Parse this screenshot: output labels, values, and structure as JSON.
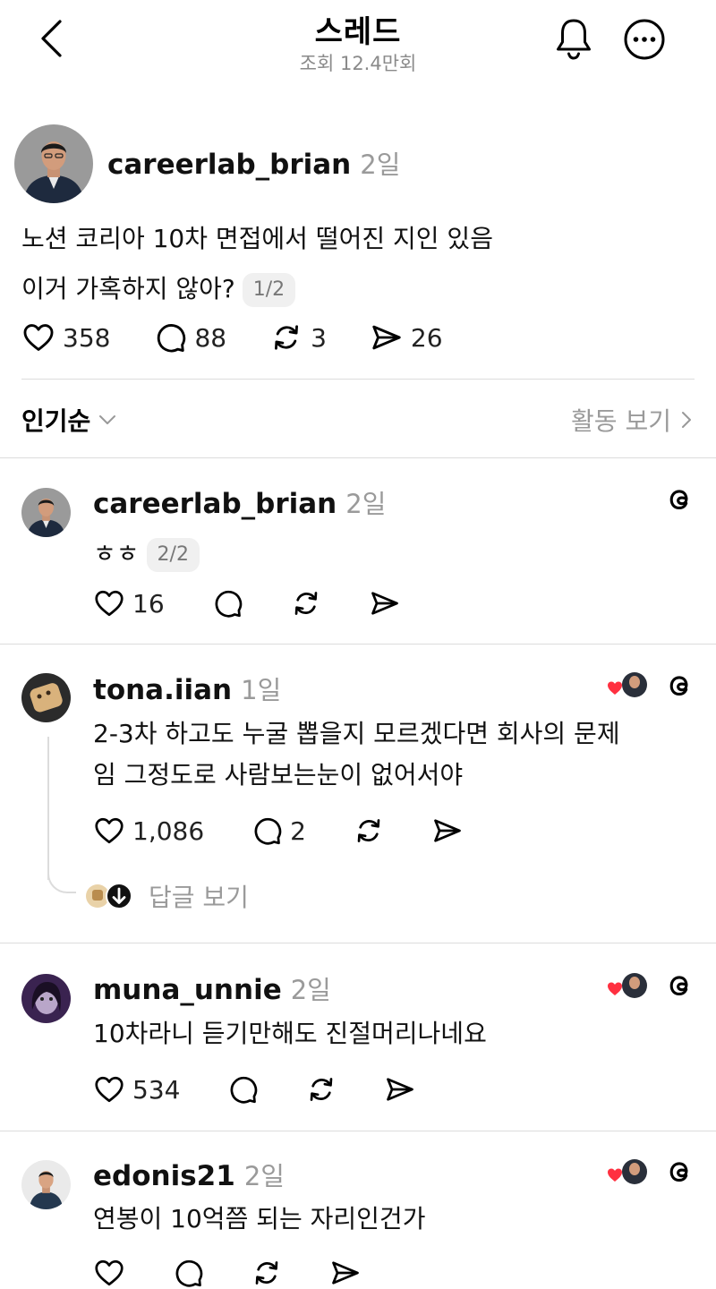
{
  "header": {
    "title": "스레드",
    "views": "조회 12.4만회"
  },
  "post": {
    "username": "careerlab_brian",
    "time": "2일",
    "line1": "노션 코리아 10차 면접에서 떨어진 지인 있음",
    "line2": "이거 가혹하지 않아?",
    "pager": "1/2",
    "likes": "358",
    "comments": "88",
    "reposts": "3",
    "shares": "26"
  },
  "sort": {
    "label": "인기순",
    "activity": "활동 보기"
  },
  "replies": [
    {
      "username": "careerlab_brian",
      "time": "2일",
      "text": "ㅎㅎ",
      "pager": "2/2",
      "likes": "16"
    },
    {
      "username": "tona.iian",
      "time": "1일",
      "line1": "2-3차 하고도 누굴 뽑을지 모르겠다면 회사의 문제",
      "line2": "임 그정도로 사람보는눈이 없어서야",
      "likes": "1,086",
      "comments": "2",
      "view_replies": "답글 보기"
    },
    {
      "username": "muna_unnie",
      "time": "2일",
      "text": "10차라니 듣기만해도 진절머리나네요",
      "likes": "534"
    },
    {
      "username": "edonis21",
      "time": "2일",
      "text": "연봉이 10억쯤 되는 자리인건가"
    }
  ],
  "colors": {
    "text": "#111111",
    "muted": "#9a9a9a",
    "heart": "#ff3040",
    "divider": "#dcdcdc"
  }
}
